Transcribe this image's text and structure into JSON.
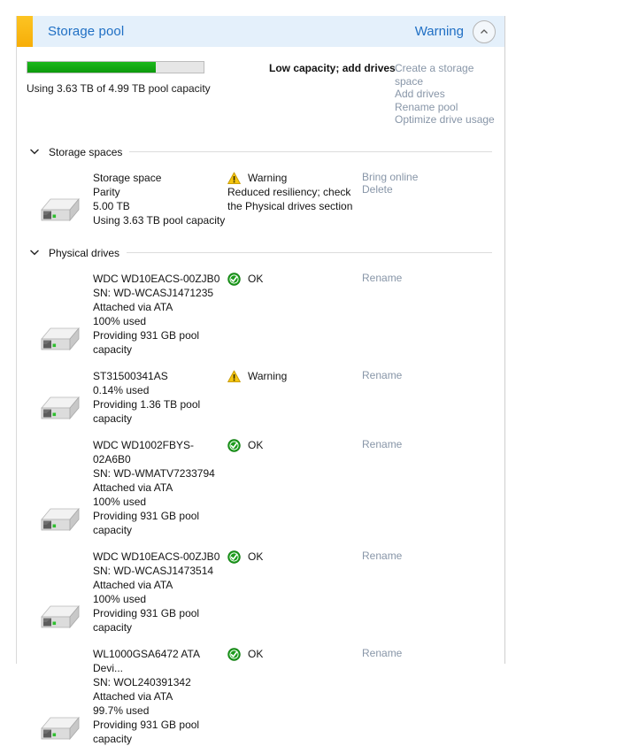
{
  "pool": {
    "title": "Storage pool",
    "status": "Warning",
    "collapse_icon": "chevron-up-circle-icon",
    "accent_color": "#f9b815",
    "capacity": {
      "used_percent": 72.7,
      "bar_color": "#12a312",
      "text": "Using 3.63 TB of 4.99 TB pool capacity",
      "message": "Low capacity; add drives"
    },
    "links": [
      "Create a storage space",
      "Add drives",
      "Rename pool",
      "Optimize drive usage"
    ]
  },
  "sections": [
    {
      "id": "storage-spaces",
      "title": "Storage spaces",
      "expanded": true,
      "items": [
        {
          "icon": "drive-icon",
          "lines": [
            "Storage space",
            "Parity",
            "5.00 TB",
            "Using 3.63 TB pool capacity"
          ],
          "status_icon": "warning-icon",
          "status": "Warning",
          "status_detail": "Reduced resiliency; check the Physical drives section",
          "actions": [
            "Bring online",
            "Delete"
          ]
        }
      ]
    },
    {
      "id": "physical-drives",
      "title": "Physical drives",
      "expanded": true,
      "items": [
        {
          "icon": "drive-icon",
          "lines": [
            "WDC WD10EACS-00ZJB0",
            "SN: WD-WCASJ1471235",
            "Attached via ATA",
            "100% used",
            "Providing 931 GB pool capacity"
          ],
          "status_icon": "ok-icon",
          "status": "OK",
          "status_detail": "",
          "actions": [
            "Rename"
          ]
        },
        {
          "icon": "drive-icon",
          "lines": [
            "ST31500341AS",
            "0.14% used",
            "Providing 1.36 TB pool capacity"
          ],
          "status_icon": "warning-icon",
          "status": "Warning",
          "status_detail": "",
          "actions": [
            "Rename"
          ]
        },
        {
          "icon": "drive-icon",
          "lines": [
            "WDC WD1002FBYS-02A6B0",
            "SN: WD-WMATV7233794",
            "Attached via ATA",
            "100% used",
            "Providing 931 GB pool capacity"
          ],
          "status_icon": "ok-icon",
          "status": "OK",
          "status_detail": "",
          "actions": [
            "Rename"
          ]
        },
        {
          "icon": "drive-icon",
          "lines": [
            "WDC WD10EACS-00ZJB0",
            "SN: WD-WCASJ1473514",
            "Attached via ATA",
            "100% used",
            "Providing 931 GB pool capacity"
          ],
          "status_icon": "ok-icon",
          "status": "OK",
          "status_detail": "",
          "actions": [
            "Rename"
          ]
        },
        {
          "icon": "drive-icon",
          "lines": [
            "WL1000GSA6472 ATA Devi...",
            "SN: WOL240391342",
            "Attached via ATA",
            "99.7% used",
            "Providing 931 GB pool capacity"
          ],
          "status_icon": "ok-icon",
          "status": "OK",
          "status_detail": "",
          "actions": [
            "Rename"
          ]
        }
      ]
    }
  ]
}
